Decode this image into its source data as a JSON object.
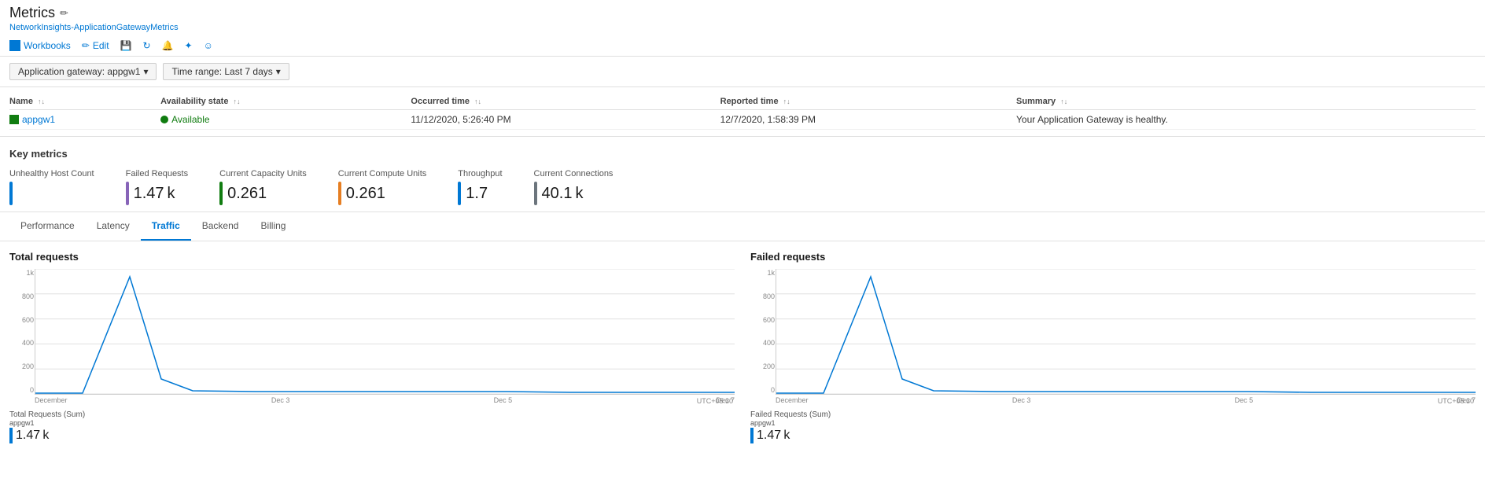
{
  "page": {
    "title": "Metrics",
    "breadcrumb": "NetworkInsights-ApplicationGatewayMetrics"
  },
  "toolbar": {
    "workbooks_label": "Workbooks",
    "edit_label": "Edit",
    "save_label": "Save",
    "refresh_label": "Refresh",
    "alerts_label": "Alerts",
    "share_label": "Share",
    "feedback_label": "Feedback"
  },
  "filters": {
    "gateway_label": "Application gateway: appgw1",
    "timerange_label": "Time range: Last 7 days"
  },
  "table": {
    "columns": [
      "Name",
      "Availability state",
      "Occurred time",
      "Reported time",
      "Summary"
    ],
    "rows": [
      {
        "name": "appgw1",
        "availability": "Available",
        "occurred": "11/12/2020, 5:26:40 PM",
        "reported": "12/7/2020, 1:58:39 PM",
        "summary": "Your Application Gateway is healthy."
      }
    ]
  },
  "key_metrics": {
    "title": "Key metrics",
    "items": [
      {
        "label": "Unhealthy Host Count",
        "value": "",
        "color": "#0078d4"
      },
      {
        "label": "Failed Requests",
        "value": "1.47 k",
        "color": "#8764b8"
      },
      {
        "label": "Current Capacity Units",
        "value": "0.261",
        "color": "#107c10"
      },
      {
        "label": "Current Compute Units",
        "value": "0.261",
        "color": "#e67e22"
      },
      {
        "label": "Throughput",
        "value": "1.7",
        "color": "#0078d4"
      },
      {
        "label": "Current Connections",
        "value": "40.1 k",
        "color": "#6c757d"
      }
    ]
  },
  "tabs": [
    "Performance",
    "Latency",
    "Traffic",
    "Backend",
    "Billing"
  ],
  "active_tab": "Traffic",
  "charts": {
    "total_requests": {
      "title": "Total requests",
      "y_labels": [
        "1k",
        "800",
        "600",
        "400",
        "200",
        "0"
      ],
      "x_labels": [
        "December",
        "Dec 3",
        "Dec 5",
        "Dec 7"
      ],
      "utc": "UTC+05:30",
      "legend_label": "Total Requests (Sum)",
      "legend_sub": "appgw1",
      "legend_value": "1.47 k"
    },
    "failed_requests": {
      "title": "Failed requests",
      "y_labels": [
        "1k",
        "800",
        "600",
        "400",
        "200",
        "0"
      ],
      "x_labels": [
        "December",
        "Dec 3",
        "Dec 5",
        "Dec 7"
      ],
      "utc": "UTC+05:30",
      "legend_label": "Failed Requests (Sum)",
      "legend_sub": "appgw1",
      "legend_value": "1.47 k"
    }
  }
}
